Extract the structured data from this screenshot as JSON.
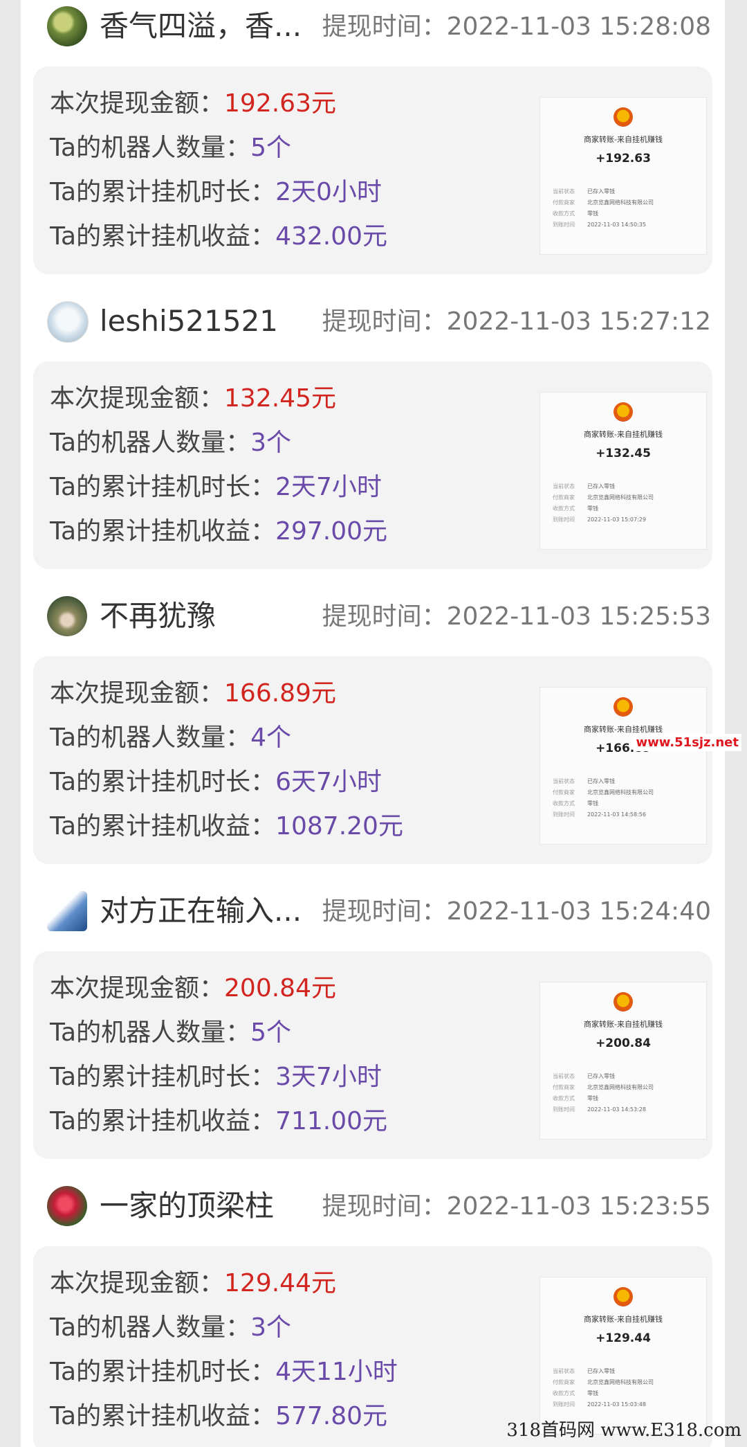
{
  "labels": {
    "withdraw_time": "提现时间：",
    "amount": "本次提现金额：",
    "robots": "Ta的机器人数量：",
    "duration": "Ta的累计挂机时长：",
    "earnings": "Ta的累计挂机收益：",
    "receipt_title": "商家转账-来自挂机赚钱",
    "receipt_status_label": "当前状态",
    "receipt_payer_label": "付款商家",
    "receipt_method_label": "收款方式",
    "receipt_time_label": "到账时间",
    "receipt_status_value": "已存入零钱",
    "receipt_payer_value": "北京览鑫网络科技有限公司",
    "receipt_method_value": "零钱"
  },
  "entries": [
    {
      "username": "香气四溢，香...",
      "time": "2022-11-03 15:28:08",
      "amount": "192.63元",
      "robots": "5个",
      "duration": "2天0小时",
      "earnings": "432.00元",
      "receipt_amount": "+192.63",
      "receipt_time": "2022-11-03 14:50:35"
    },
    {
      "username": "leshi521521",
      "time": "2022-11-03 15:27:12",
      "amount": "132.45元",
      "robots": "3个",
      "duration": "2天7小时",
      "earnings": "297.00元",
      "receipt_amount": "+132.45",
      "receipt_time": "2022-11-03 15:07:29"
    },
    {
      "username": "不再犹豫",
      "time": "2022-11-03 15:25:53",
      "amount": "166.89元",
      "robots": "4个",
      "duration": "6天7小时",
      "earnings": "1087.20元",
      "receipt_amount": "+166.89",
      "receipt_time": "2022-11-03 14:58:56"
    },
    {
      "username": "对方正在输入...",
      "time": "2022-11-03 15:24:40",
      "amount": "200.84元",
      "robots": "5个",
      "duration": "3天7小时",
      "earnings": "711.00元",
      "receipt_amount": "+200.84",
      "receipt_time": "2022-11-03 14:53:28"
    },
    {
      "username": "一家的顶梁柱",
      "time": "2022-11-03 15:23:55",
      "amount": "129.44元",
      "robots": "3个",
      "duration": "4天11小时",
      "earnings": "577.80元",
      "receipt_amount": "+129.44",
      "receipt_time": "2022-11-03 15:03:48"
    }
  ],
  "watermarks": {
    "site": "www.51sjz.net",
    "bottom": "318首码网 www.E318.com"
  }
}
